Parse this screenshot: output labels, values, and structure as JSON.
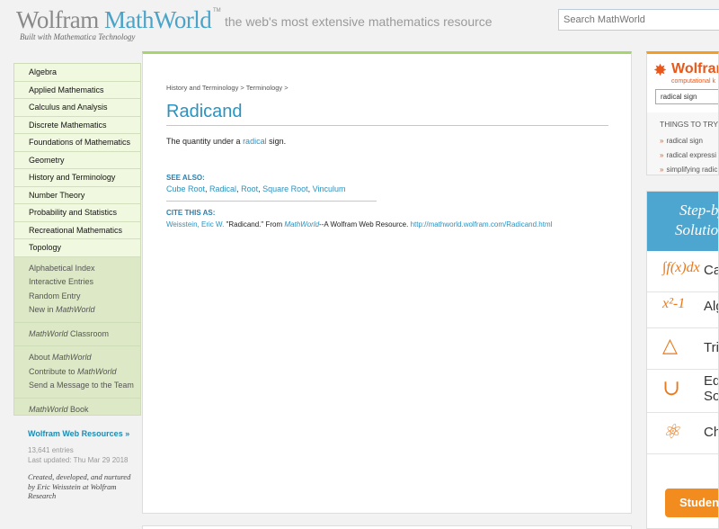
{
  "header": {
    "logo_wolfram": "Wolfram",
    "logo_mathworld": "MathWorld",
    "logo_tm": "TM",
    "tagline": "the web's most extensive mathematics resource",
    "built_with": "Built with Mathematica Technology",
    "search_placeholder": "Search MathWorld"
  },
  "nav": {
    "topics": [
      "Algebra",
      "Applied Mathematics",
      "Calculus and Analysis",
      "Discrete Mathematics",
      "Foundations of Mathematics",
      "Geometry",
      "History and Terminology",
      "Number Theory",
      "Probability and Statistics",
      "Recreational Mathematics",
      "Topology"
    ],
    "links": {
      "alphabetical_index": "Alphabetical Index",
      "interactive_entries": "Interactive Entries",
      "random_entry": "Random Entry",
      "new_in": "New in ",
      "mathworld": "MathWorld",
      "classroom": " Classroom",
      "about": "About ",
      "contribute_to": "Contribute to ",
      "send_message": "Send a Message to the Team",
      "book": " Book"
    },
    "resources": "Wolfram Web Resources »",
    "entries": "13,641 entries",
    "last_updated": "Last updated: Thu Mar 29 2018",
    "credit": "Created, developed, and nurtured by Eric Weisstein at Wolfram Research"
  },
  "main": {
    "breadcrumb": "History and Terminology > Terminology >",
    "title": "Radicand",
    "definition_pre": "The quantity under a ",
    "definition_link": "radical",
    "definition_post": " sign.",
    "see_also_heading": "SEE ALSO:",
    "see_also": [
      "Cube Root",
      "Radical",
      "Root",
      "Square Root",
      "Vinculum"
    ],
    "see_also_sep": ", ",
    "cite_heading": "CITE THIS AS:",
    "cite_author": "Weisstein, Eric W.",
    "cite_title": " \"Radicand.\" From ",
    "cite_mathworld": "MathWorld",
    "cite_source": "--A Wolfram Web Resource. ",
    "cite_url": "http://mathworld.wolfram.com/Radicand.html"
  },
  "alpha": {
    "title": "Wolfram",
    "subtitle": "computational k",
    "input_value": "radical sign",
    "things_to_try": "THINGS TO TRY",
    "dot": "»",
    "tries": [
      "radical sign",
      "radical expressi",
      "simplifying radic"
    ]
  },
  "steps": {
    "heading_1": "Step-by",
    "heading_2": "Solutio",
    "rows": [
      {
        "icon": "∫f(x)dx",
        "label": "Calc"
      },
      {
        "icon": "x²-1",
        "label": "Alge"
      },
      {
        "icon": "△",
        "label": "Trig"
      },
      {
        "icon": "∪",
        "label": "Equ"
      },
      {
        "icon": "⚛",
        "label": "Che"
      }
    ],
    "row4_label_2": "Sol",
    "students_button": "Student"
  }
}
